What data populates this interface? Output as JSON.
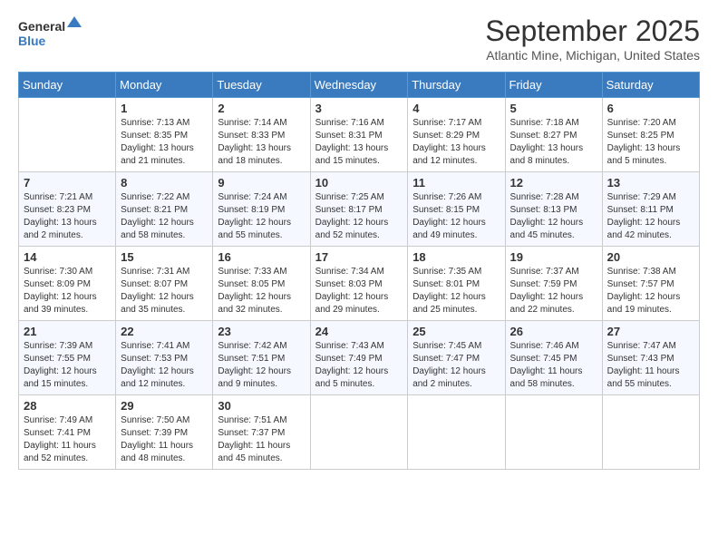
{
  "logo": {
    "text_general": "General",
    "text_blue": "Blue"
  },
  "title": "September 2025",
  "location": "Atlantic Mine, Michigan, United States",
  "days_of_week": [
    "Sunday",
    "Monday",
    "Tuesday",
    "Wednesday",
    "Thursday",
    "Friday",
    "Saturday"
  ],
  "weeks": [
    [
      {
        "day": "",
        "sunrise": "",
        "sunset": "",
        "daylight": ""
      },
      {
        "day": "1",
        "sunrise": "Sunrise: 7:13 AM",
        "sunset": "Sunset: 8:35 PM",
        "daylight": "Daylight: 13 hours and 21 minutes."
      },
      {
        "day": "2",
        "sunrise": "Sunrise: 7:14 AM",
        "sunset": "Sunset: 8:33 PM",
        "daylight": "Daylight: 13 hours and 18 minutes."
      },
      {
        "day": "3",
        "sunrise": "Sunrise: 7:16 AM",
        "sunset": "Sunset: 8:31 PM",
        "daylight": "Daylight: 13 hours and 15 minutes."
      },
      {
        "day": "4",
        "sunrise": "Sunrise: 7:17 AM",
        "sunset": "Sunset: 8:29 PM",
        "daylight": "Daylight: 13 hours and 12 minutes."
      },
      {
        "day": "5",
        "sunrise": "Sunrise: 7:18 AM",
        "sunset": "Sunset: 8:27 PM",
        "daylight": "Daylight: 13 hours and 8 minutes."
      },
      {
        "day": "6",
        "sunrise": "Sunrise: 7:20 AM",
        "sunset": "Sunset: 8:25 PM",
        "daylight": "Daylight: 13 hours and 5 minutes."
      }
    ],
    [
      {
        "day": "7",
        "sunrise": "Sunrise: 7:21 AM",
        "sunset": "Sunset: 8:23 PM",
        "daylight": "Daylight: 13 hours and 2 minutes."
      },
      {
        "day": "8",
        "sunrise": "Sunrise: 7:22 AM",
        "sunset": "Sunset: 8:21 PM",
        "daylight": "Daylight: 12 hours and 58 minutes."
      },
      {
        "day": "9",
        "sunrise": "Sunrise: 7:24 AM",
        "sunset": "Sunset: 8:19 PM",
        "daylight": "Daylight: 12 hours and 55 minutes."
      },
      {
        "day": "10",
        "sunrise": "Sunrise: 7:25 AM",
        "sunset": "Sunset: 8:17 PM",
        "daylight": "Daylight: 12 hours and 52 minutes."
      },
      {
        "day": "11",
        "sunrise": "Sunrise: 7:26 AM",
        "sunset": "Sunset: 8:15 PM",
        "daylight": "Daylight: 12 hours and 49 minutes."
      },
      {
        "day": "12",
        "sunrise": "Sunrise: 7:28 AM",
        "sunset": "Sunset: 8:13 PM",
        "daylight": "Daylight: 12 hours and 45 minutes."
      },
      {
        "day": "13",
        "sunrise": "Sunrise: 7:29 AM",
        "sunset": "Sunset: 8:11 PM",
        "daylight": "Daylight: 12 hours and 42 minutes."
      }
    ],
    [
      {
        "day": "14",
        "sunrise": "Sunrise: 7:30 AM",
        "sunset": "Sunset: 8:09 PM",
        "daylight": "Daylight: 12 hours and 39 minutes."
      },
      {
        "day": "15",
        "sunrise": "Sunrise: 7:31 AM",
        "sunset": "Sunset: 8:07 PM",
        "daylight": "Daylight: 12 hours and 35 minutes."
      },
      {
        "day": "16",
        "sunrise": "Sunrise: 7:33 AM",
        "sunset": "Sunset: 8:05 PM",
        "daylight": "Daylight: 12 hours and 32 minutes."
      },
      {
        "day": "17",
        "sunrise": "Sunrise: 7:34 AM",
        "sunset": "Sunset: 8:03 PM",
        "daylight": "Daylight: 12 hours and 29 minutes."
      },
      {
        "day": "18",
        "sunrise": "Sunrise: 7:35 AM",
        "sunset": "Sunset: 8:01 PM",
        "daylight": "Daylight: 12 hours and 25 minutes."
      },
      {
        "day": "19",
        "sunrise": "Sunrise: 7:37 AM",
        "sunset": "Sunset: 7:59 PM",
        "daylight": "Daylight: 12 hours and 22 minutes."
      },
      {
        "day": "20",
        "sunrise": "Sunrise: 7:38 AM",
        "sunset": "Sunset: 7:57 PM",
        "daylight": "Daylight: 12 hours and 19 minutes."
      }
    ],
    [
      {
        "day": "21",
        "sunrise": "Sunrise: 7:39 AM",
        "sunset": "Sunset: 7:55 PM",
        "daylight": "Daylight: 12 hours and 15 minutes."
      },
      {
        "day": "22",
        "sunrise": "Sunrise: 7:41 AM",
        "sunset": "Sunset: 7:53 PM",
        "daylight": "Daylight: 12 hours and 12 minutes."
      },
      {
        "day": "23",
        "sunrise": "Sunrise: 7:42 AM",
        "sunset": "Sunset: 7:51 PM",
        "daylight": "Daylight: 12 hours and 9 minutes."
      },
      {
        "day": "24",
        "sunrise": "Sunrise: 7:43 AM",
        "sunset": "Sunset: 7:49 PM",
        "daylight": "Daylight: 12 hours and 5 minutes."
      },
      {
        "day": "25",
        "sunrise": "Sunrise: 7:45 AM",
        "sunset": "Sunset: 7:47 PM",
        "daylight": "Daylight: 12 hours and 2 minutes."
      },
      {
        "day": "26",
        "sunrise": "Sunrise: 7:46 AM",
        "sunset": "Sunset: 7:45 PM",
        "daylight": "Daylight: 11 hours and 58 minutes."
      },
      {
        "day": "27",
        "sunrise": "Sunrise: 7:47 AM",
        "sunset": "Sunset: 7:43 PM",
        "daylight": "Daylight: 11 hours and 55 minutes."
      }
    ],
    [
      {
        "day": "28",
        "sunrise": "Sunrise: 7:49 AM",
        "sunset": "Sunset: 7:41 PM",
        "daylight": "Daylight: 11 hours and 52 minutes."
      },
      {
        "day": "29",
        "sunrise": "Sunrise: 7:50 AM",
        "sunset": "Sunset: 7:39 PM",
        "daylight": "Daylight: 11 hours and 48 minutes."
      },
      {
        "day": "30",
        "sunrise": "Sunrise: 7:51 AM",
        "sunset": "Sunset: 7:37 PM",
        "daylight": "Daylight: 11 hours and 45 minutes."
      },
      {
        "day": "",
        "sunrise": "",
        "sunset": "",
        "daylight": ""
      },
      {
        "day": "",
        "sunrise": "",
        "sunset": "",
        "daylight": ""
      },
      {
        "day": "",
        "sunrise": "",
        "sunset": "",
        "daylight": ""
      },
      {
        "day": "",
        "sunrise": "",
        "sunset": "",
        "daylight": ""
      }
    ]
  ]
}
